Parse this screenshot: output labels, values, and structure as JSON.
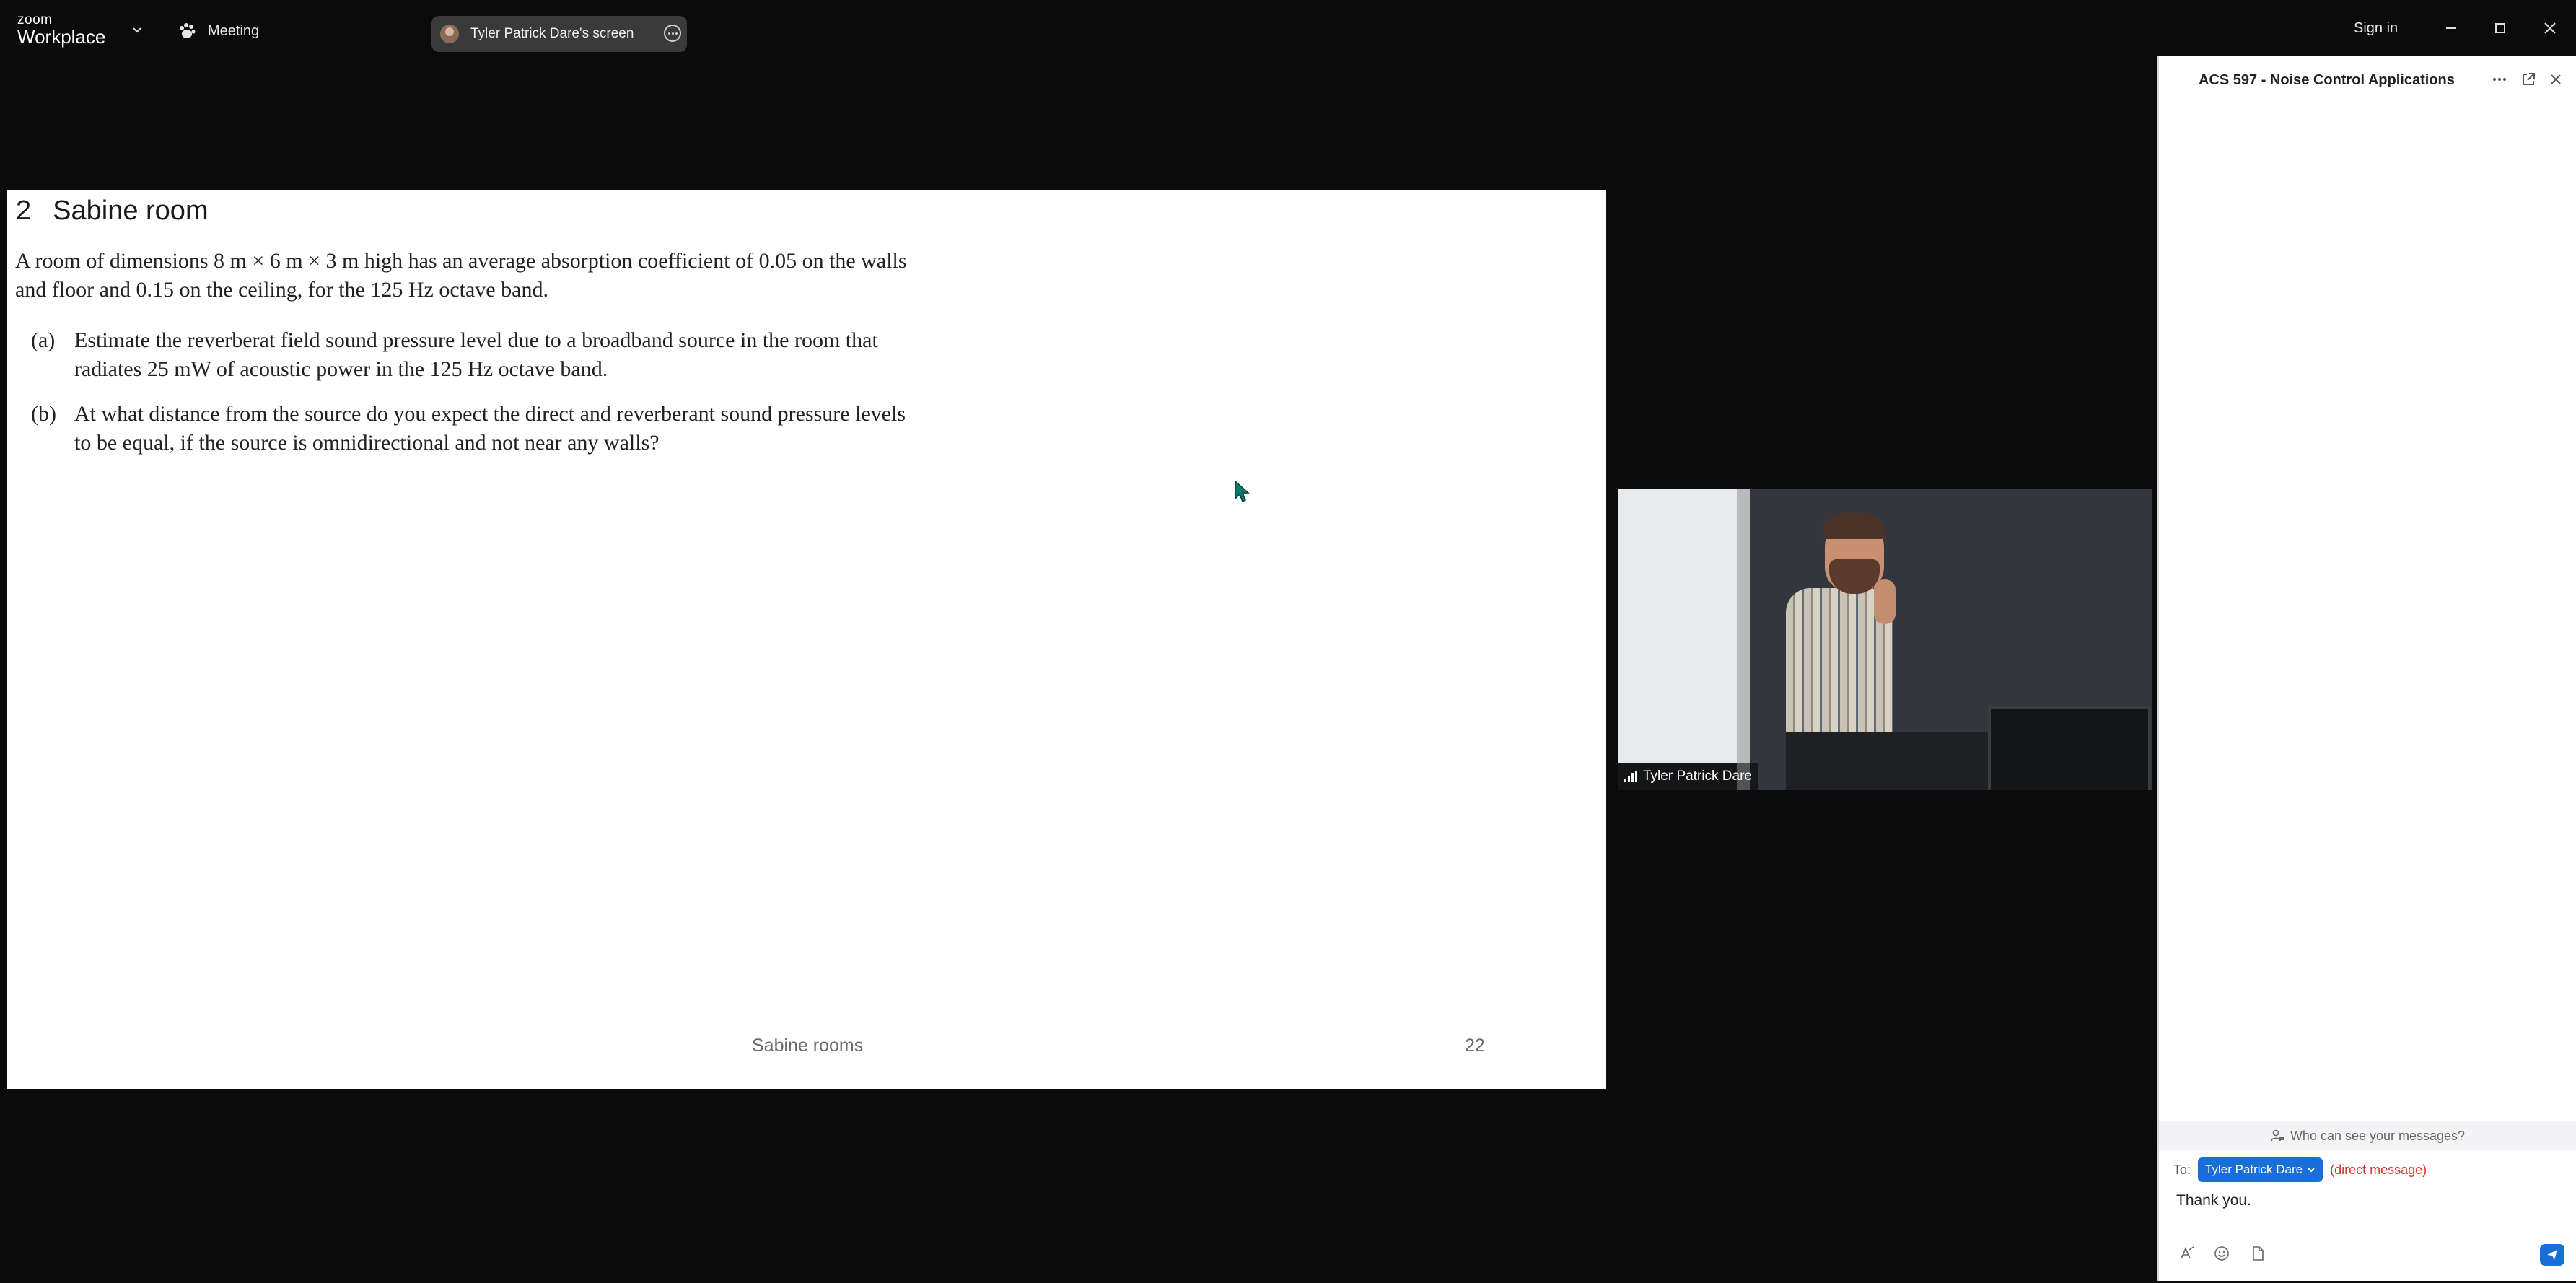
{
  "app": {
    "brand_small": "zoom",
    "brand_large": "Workplace",
    "meeting_label": "Meeting",
    "screen_share_label": "Tyler Patrick Dare's screen",
    "sign_in": "Sign in"
  },
  "slide": {
    "section_number": "2",
    "title": "Sabine room",
    "paragraph": "A room of dimensions 8 m × 6 m × 3 m high has an average absorption coefficient of 0.05 on the walls and floor and 0.15 on the ceiling, for the 125 Hz octave band.",
    "questions": [
      {
        "label": "(a)",
        "text": "Estimate the reverberat field sound pressure level due to a broadband source in the room that radiates 25 mW of acoustic power in the 125 Hz octave band."
      },
      {
        "label": "(b)",
        "text": "At what distance from the source do you expect the direct and reverberant sound pressure levels to be equal, if the source is omnidirectional and not near any walls?"
      }
    ],
    "footer_title": "Sabine rooms",
    "page_number": "22"
  },
  "video": {
    "participant_name": "Tyler Patrick Dare"
  },
  "chat": {
    "title": "ACS 597 - Noise Control Applications",
    "privacy_hint": "Who can see your messages?",
    "to_label": "To:",
    "recipient": "Tyler Patrick Dare",
    "recipient_note": "(direct message)",
    "draft_message": "Thank you."
  },
  "colors": {
    "accent": "#1a6fd6",
    "warning": "#d9342b",
    "background": "#0b0b0b"
  }
}
